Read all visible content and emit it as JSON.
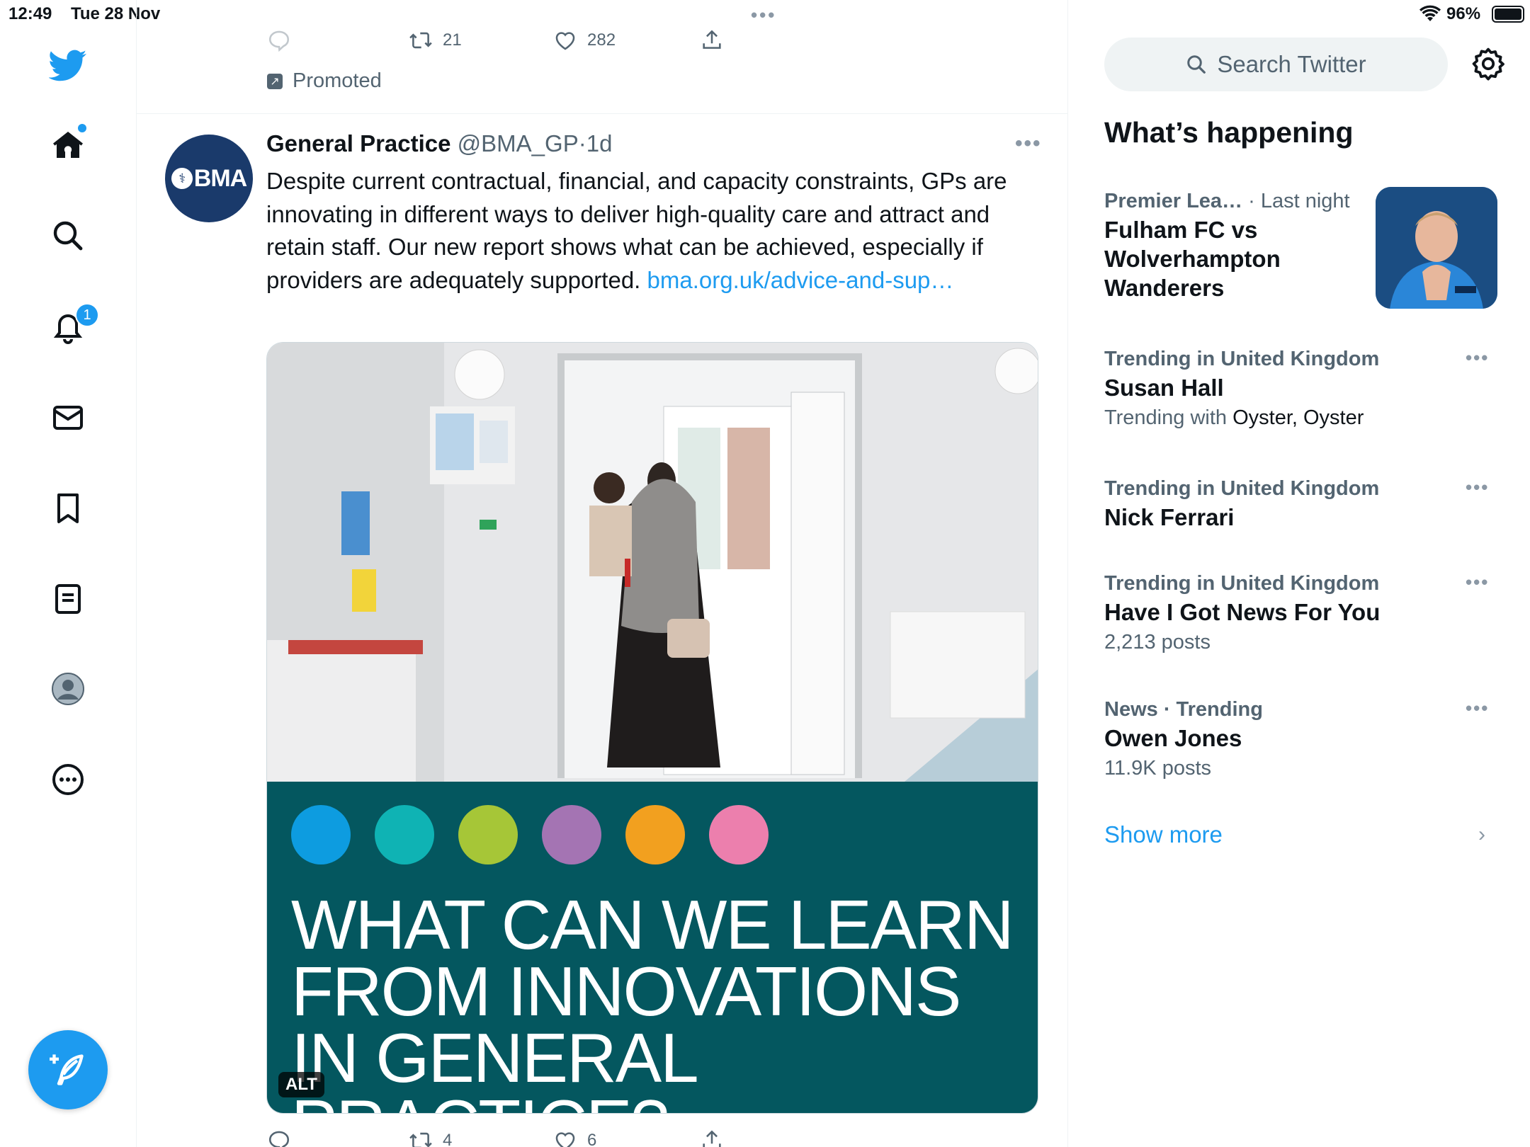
{
  "status_bar": {
    "time": "12:49",
    "date": "Tue 28 Nov",
    "battery": "96%"
  },
  "nav": {
    "notifications_badge": "1"
  },
  "previous_tweet": {
    "retweets": "21",
    "likes": "282",
    "promoted_label": "Promoted"
  },
  "tweet": {
    "name": "General Practice",
    "handle": "@BMA_GP",
    "separator": "·",
    "time": "1d",
    "avatar_text": "BMA",
    "text": "Despite current contractual, financial, and capacity constraints, GPs are innovating in different ways to deliver high-quality care and attract and retain staff. Our new report shows what can be achieved, especially if providers are adequately supported. ",
    "link": "bma.org.uk/advice-and-sup…",
    "media_title": "WHAT CAN WE LEARN FROM INNOVATIONS IN GENERAL PRACTICE?",
    "alt_label": "ALT",
    "circle_colors": [
      "#0d9ce0",
      "#0fb3b4",
      "#a6c637",
      "#a474b3",
      "#f2a01f",
      "#ec7fad"
    ],
    "retweets": "4",
    "likes": "6"
  },
  "sidebar": {
    "search_placeholder": "Search Twitter",
    "whats_happening": "What’s happening",
    "trends": [
      {
        "meta_bold": "Premier Lea…",
        "meta_rest": " · Last night",
        "title": "Fulham FC vs Wolverhampton Wanderers"
      },
      {
        "meta_bold": "Trending in United Kingdom",
        "title": "Susan Hall",
        "sub_prefix": "Trending with ",
        "sub_dark": "Oyster, Oyster"
      },
      {
        "meta_bold": "Trending in United Kingdom",
        "title": "Nick Ferrari"
      },
      {
        "meta_bold": "Trending in United Kingdom",
        "title": "Have I Got News For You",
        "sub": "2,213 posts"
      },
      {
        "meta_bold": "News · Trending",
        "title": "Owen Jones",
        "sub": "11.9K posts"
      }
    ],
    "show_more": "Show more"
  },
  "colors": {
    "accent": "#1d9bf0",
    "report_bg": "#04575f"
  }
}
